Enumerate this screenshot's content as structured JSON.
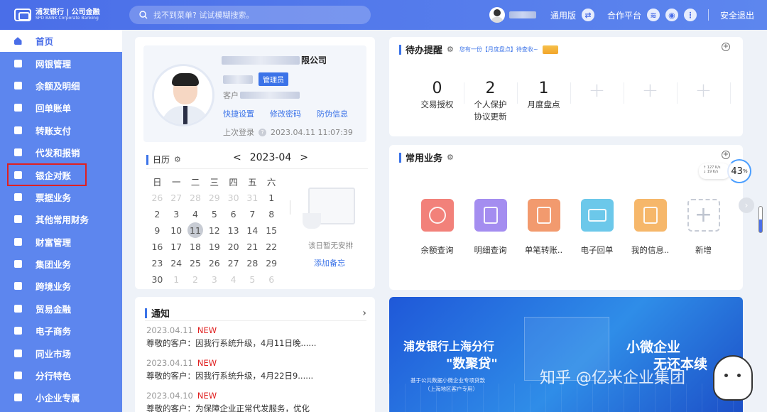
{
  "header": {
    "logo_cn": "浦发银行 | 公司金融",
    "logo_en": "SPD BANK  Corporate Banking",
    "search_placeholder": "找不到菜单? 试试模糊搜索。",
    "mode": "通用版",
    "partner": "合作平台",
    "logout": "安全退出"
  },
  "sidebar": {
    "items": [
      {
        "label": "首页"
      },
      {
        "label": "网银管理"
      },
      {
        "label": "余额及明细"
      },
      {
        "label": "回单账单"
      },
      {
        "label": "转账支付"
      },
      {
        "label": "代发和报销"
      },
      {
        "label": "银企对账"
      },
      {
        "label": "票据业务"
      },
      {
        "label": "其他常用财务"
      },
      {
        "label": "财富管理"
      },
      {
        "label": "集团业务"
      },
      {
        "label": "跨境业务"
      },
      {
        "label": "贸易金融"
      },
      {
        "label": "电子商务"
      },
      {
        "label": "同业市场"
      },
      {
        "label": "分行特色"
      },
      {
        "label": "小企业专属"
      }
    ]
  },
  "profile": {
    "company_suffix": "限公司",
    "role": "管理员",
    "customer_label": "客户",
    "links": [
      "快捷设置",
      "修改密码",
      "防伪信息"
    ],
    "last_login_label": "上次登录",
    "last_login_time": "2023.04.11 11:07:39"
  },
  "calendar": {
    "title": "日历",
    "month": "2023-04",
    "prev": "<",
    "next": ">",
    "weekdays": [
      "日",
      "一",
      "二",
      "三",
      "四",
      "五",
      "六"
    ],
    "days": [
      [
        "26",
        "27",
        "28",
        "29",
        "30",
        "31",
        "1"
      ],
      [
        "2",
        "3",
        "4",
        "5",
        "6",
        "7",
        "8"
      ],
      [
        "9",
        "10",
        "11",
        "12",
        "13",
        "14",
        "15"
      ],
      [
        "16",
        "17",
        "18",
        "19",
        "20",
        "21",
        "22"
      ],
      [
        "23",
        "24",
        "25",
        "26",
        "27",
        "28",
        "29"
      ],
      [
        "30",
        "1",
        "2",
        "3",
        "4",
        "5",
        "6"
      ]
    ],
    "no_plan": "该日暂无安排",
    "add_note": "添加备忘"
  },
  "notice": {
    "title": "通知",
    "items": [
      {
        "date": "2023.04.11",
        "badge": "NEW",
        "text": "尊敬的客户：因我行系统升级，4月11日晚......"
      },
      {
        "date": "2023.04.11",
        "badge": "NEW",
        "text": "尊敬的客户：因我行系统升级，4月22日9......"
      },
      {
        "date": "2023.04.10",
        "badge": "NEW",
        "text": "尊敬的客户：为保障企业正常代发服务，优化"
      }
    ]
  },
  "todo": {
    "title": "待办提醒",
    "note": "您有一份【月度盘点】待查收~",
    "items": [
      {
        "num": "0",
        "label": "交易授权"
      },
      {
        "num": "2",
        "label": "个人保护\n协议更新"
      },
      {
        "num": "1",
        "label": "月度盘点"
      }
    ],
    "add_symbol": "+"
  },
  "common": {
    "title": "常用业务",
    "items": [
      {
        "label": "余额查询",
        "color": "#f2817a",
        "icon": "money-bag-icon"
      },
      {
        "label": "明细查询",
        "color": "#a48df0",
        "icon": "document-icon"
      },
      {
        "label": "单笔转账..",
        "color": "#f29a6e",
        "icon": "transfer-icon"
      },
      {
        "label": "电子回单",
        "color": "#6cc8ea",
        "icon": "receipt-icon"
      },
      {
        "label": "我的信息..",
        "color": "#f6b76a",
        "icon": "chart-icon"
      },
      {
        "label": "新增",
        "color": "#ffffff",
        "icon": "plus-icon"
      }
    ]
  },
  "net": {
    "up": "↑ 127 K/s",
    "down": "↓ 19 K/s",
    "percent": "43",
    "unit": "%"
  },
  "banner": {
    "line1": "浦发银行上海分行",
    "line2": "\"数聚贷\"",
    "line3": "基于公共数据小微企业专项贷款",
    "line4": "（上海地区客户专用）",
    "line5": "小微企业",
    "line6": "无还本续",
    "watermark": "知乎 @亿米企业集团"
  }
}
